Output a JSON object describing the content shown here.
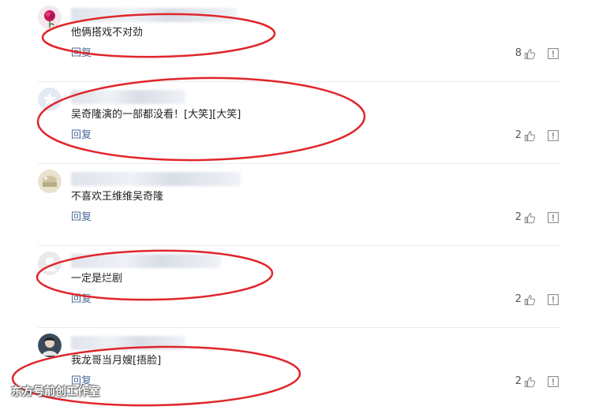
{
  "comments": [
    {
      "text": "他俩搭戏不对劲",
      "reply_label": "回复",
      "likes": "8",
      "avatar_icon": "rose-avatar",
      "highlighted": true
    },
    {
      "text": "吴奇隆演的一部都没看！[大笑][大笑]",
      "reply_label": "回复",
      "likes": "2",
      "avatar_icon": "default-avatar-blue",
      "highlighted": true
    },
    {
      "text": "不喜欢王维维吴奇隆",
      "reply_label": "回复",
      "likes": "2",
      "avatar_icon": "landscape-avatar",
      "highlighted": false
    },
    {
      "text": "一定是烂剧",
      "reply_label": "回复",
      "likes": "2",
      "avatar_icon": "default-avatar-gray",
      "highlighted": true
    },
    {
      "text": "我龙哥当月嫂[捂脸]",
      "reply_label": "回复",
      "likes": "2",
      "avatar_icon": "person-photo-avatar",
      "highlighted": true
    }
  ],
  "watermark": "东方号前创工作室",
  "colors": {
    "highlight_ellipse": "#e0262b",
    "reply_link": "#4a6a9a",
    "divider": "#ececec"
  }
}
